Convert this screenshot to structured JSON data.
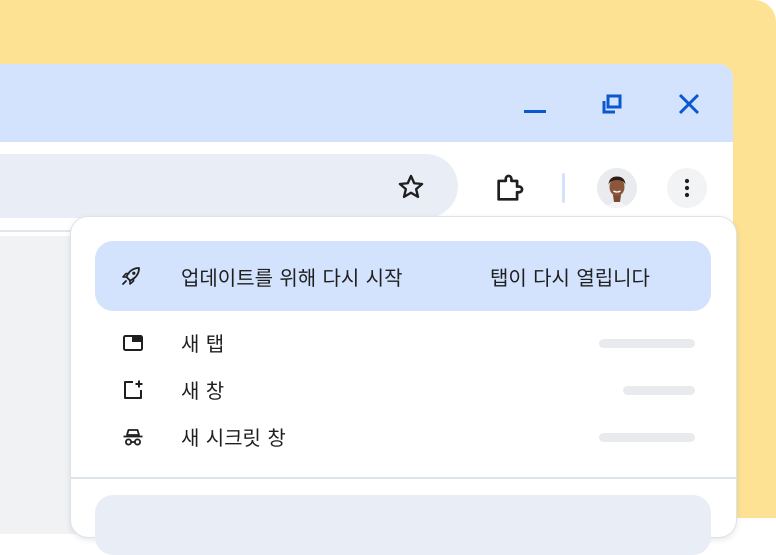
{
  "colors": {
    "background_card": "#fde293",
    "titlebar": "#d3e3fd",
    "omnibox": "#e9eef6",
    "accent_blue": "#0b57d0",
    "highlight_row": "#d3e3fd"
  },
  "window_controls": [
    {
      "name": "minimize",
      "icon": "minimize-icon"
    },
    {
      "name": "restore",
      "icon": "restore-icon"
    },
    {
      "name": "close",
      "icon": "close-icon"
    }
  ],
  "toolbar": {
    "bookmark_icon": "star-icon",
    "extensions_icon": "puzzle-icon",
    "profile_icon": "avatar",
    "menu_icon": "more-vert-icon"
  },
  "menu": {
    "update": {
      "icon": "rocket-icon",
      "label": "업데이트를 위해 다시 시작",
      "sublabel": "탭이 다시 열립니다"
    },
    "items": [
      {
        "icon": "new-tab-icon",
        "label": "새 탭"
      },
      {
        "icon": "new-window-icon",
        "label": "새 창"
      },
      {
        "icon": "incognito-icon",
        "label": "새 시크릿 창"
      }
    ]
  }
}
